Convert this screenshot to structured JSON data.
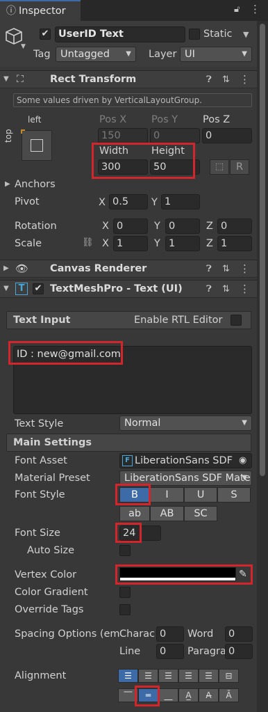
{
  "tab": {
    "title": "Inspector"
  },
  "object": {
    "name": "UserID Text",
    "static_label": "Static",
    "tag_label": "Tag",
    "tag_value": "Untagged",
    "layer_label": "Layer",
    "layer_value": "UI"
  },
  "rect": {
    "title": "Rect Transform",
    "info": "Some values driven by VerticalLayoutGroup.",
    "anchor_h": "left",
    "anchor_v": "top",
    "posx_label": "Pos X",
    "posy_label": "Pos Y",
    "posz_label": "Pos Z",
    "posx": "150",
    "posy": "0",
    "posz": "0",
    "width_label": "Width",
    "height_label": "Height",
    "width": "300",
    "height": "50",
    "r_btn": "R",
    "anchors_label": "Anchors",
    "pivot_label": "Pivot",
    "pivot_x_label": "X",
    "pivot_x": "0.5",
    "pivot_y_label": "Y",
    "pivot_y": "1",
    "rotation_label": "Rotation",
    "rot_x": "0",
    "rot_y": "0",
    "rot_z": "0",
    "scale_label": "Scale",
    "scale_x": "1",
    "scale_y": "1",
    "scale_z": "1",
    "x": "X",
    "y": "Y",
    "z": "Z"
  },
  "canvas_renderer": {
    "title": "Canvas Renderer"
  },
  "tmp": {
    "title": "TextMeshPro - Text (UI)",
    "text_input_label": "Text Input",
    "rtl_label": "Enable RTL Editor",
    "text_value": "ID : new@gmail.com",
    "text_style_label": "Text Style",
    "text_style_value": "Normal",
    "main_settings": "Main Settings",
    "font_asset_label": "Font Asset",
    "font_asset_value": "LiberationSans SDF",
    "material_label": "Material Preset",
    "material_value": "LiberationSans SDF Mate",
    "font_style_label": "Font Style",
    "styles_row1": [
      "B",
      "I",
      "U",
      "S"
    ],
    "styles_row2": [
      "ab",
      "AB",
      "SC"
    ],
    "font_size_label": "Font Size",
    "font_size": "24",
    "auto_size_label": "Auto Size",
    "vertex_color_label": "Vertex Color",
    "color_gradient_label": "Color Gradient",
    "override_tags_label": "Override Tags",
    "spacing_label": "Spacing Options (em",
    "char_label": "Charac",
    "char_value": "0",
    "word_label": "Word",
    "word_value": "0",
    "line_label": "Line",
    "line_value": "0",
    "para_label": "Paragra",
    "para_value": "0",
    "alignment_label": "Alignment"
  },
  "colors": {
    "highlight": "#d3262c",
    "accent": "#3d6ba8",
    "vertex_color": "#000000"
  }
}
